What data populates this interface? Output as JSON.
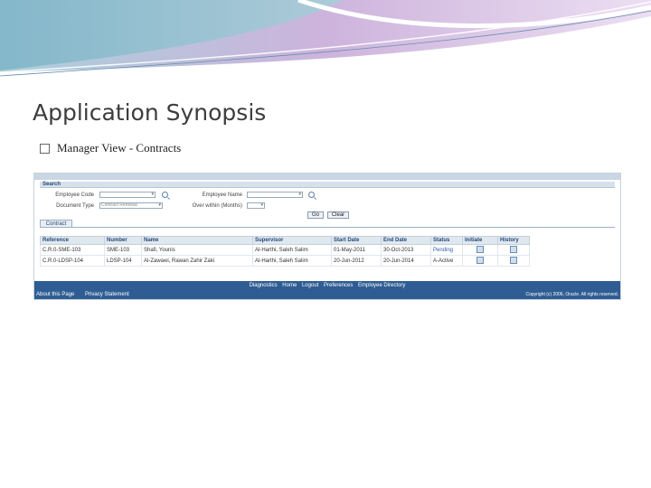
{
  "slide": {
    "title": "Application Synopsis",
    "bullet": "Manager View - Contracts"
  },
  "search": {
    "header": "Search",
    "employee_code_label": "Employee Code",
    "employee_name_label": "Employee Name",
    "document_type_label": "Document Type",
    "document_type_value": "Contract Renewal",
    "over_within_label": "Over within (Months)",
    "go_label": "Go",
    "clear_label": "Clear"
  },
  "tab": {
    "label": "Contract"
  },
  "table": {
    "headers": [
      "Reference",
      "Number",
      "Name",
      "Supervisor",
      "Start Date",
      "End Date",
      "Status",
      "Initiate",
      "History"
    ],
    "rows": [
      [
        "C.R.0-SME-103",
        "SME-103",
        "Shafi, Younis",
        "Al-Harthi, Saleh Salim",
        "01-May-2011",
        "30-Oct-2013",
        "Pending",
        "",
        ""
      ],
      [
        "C.R.0-LDSP-104",
        "LDSP-104",
        "Al-Zawawi, Rawan Zahir Zaki",
        "Al-Harthi, Saleh Salim",
        "20-Jun-2012",
        "20-Jun-2014",
        "A-Active",
        "",
        ""
      ]
    ]
  },
  "footer": {
    "links": [
      "Diagnostics",
      "Home",
      "Logout",
      "Preferences",
      "Employee Directory"
    ],
    "left_links": [
      "About this Page",
      "Privacy Statement"
    ],
    "copyright": "Copyright (c) 2006, Oracle. All rights reserved."
  },
  "colors": {
    "footer": "#2f5d93",
    "accent": "#254a77",
    "swoosh": "#7fb5c8"
  }
}
